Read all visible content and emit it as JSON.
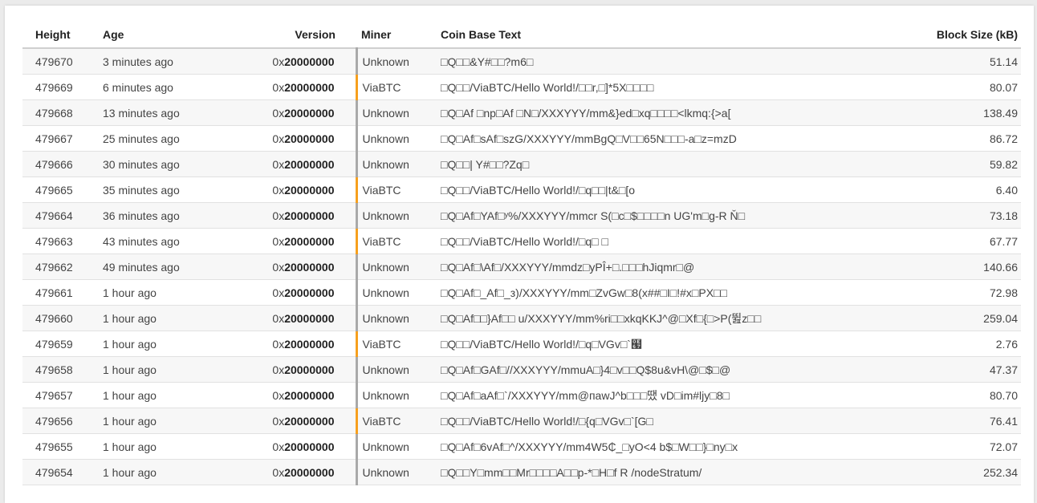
{
  "table": {
    "columns": {
      "height": "Height",
      "age": "Age",
      "version": "Version",
      "miner": "Miner",
      "coinbase": "Coin Base Text",
      "size": "Block Size (kB)"
    },
    "rows": [
      {
        "height": "479670",
        "age": "3 minutes ago",
        "version_prefix": "0x",
        "version_value": "20000000",
        "miner": "Unknown",
        "coinbase": "□Q□□&Y#□□?m6□",
        "size": "51.14"
      },
      {
        "height": "479669",
        "age": "6 minutes ago",
        "version_prefix": "0x",
        "version_value": "20000000",
        "miner": "ViaBTC",
        "coinbase": "□Q□□/ViaBTC/Hello World!/□□r,□]*5X□□□□",
        "size": "80.07"
      },
      {
        "height": "479668",
        "age": "13 minutes ago",
        "version_prefix": "0x",
        "version_value": "20000000",
        "miner": "Unknown",
        "coinbase": "□Q□Af □np□Af □N□/XXXYYY/mm&}ed□xq□□□□<lkmq:{>a[",
        "size": "138.49"
      },
      {
        "height": "479667",
        "age": "25 minutes ago",
        "version_prefix": "0x",
        "version_value": "20000000",
        "miner": "Unknown",
        "coinbase": "□Q□Af□sAf□szG/XXXYYY/mmBgQ□V□□65N□□□-a□z=mzD",
        "size": "86.72"
      },
      {
        "height": "479666",
        "age": "30 minutes ago",
        "version_prefix": "0x",
        "version_value": "20000000",
        "miner": "Unknown",
        "coinbase": "□Q□□| Y#□□?Zq□",
        "size": "59.82"
      },
      {
        "height": "479665",
        "age": "35 minutes ago",
        "version_prefix": "0x",
        "version_value": "20000000",
        "miner": "ViaBTC",
        "coinbase": "□Q□□/ViaBTC/Hello World!/□q□□|t&□[o",
        "size": "6.40"
      },
      {
        "height": "479664",
        "age": "36 minutes ago",
        "version_prefix": "0x",
        "version_value": "20000000",
        "miner": "Unknown",
        "coinbase": "□Q□Af□YAf□ʸ%/XXXYYY/mmcr S(□c□$□□□□n UG'm□g-R Ň□",
        "size": "73.18"
      },
      {
        "height": "479663",
        "age": "43 minutes ago",
        "version_prefix": "0x",
        "version_value": "20000000",
        "miner": "ViaBTC",
        "coinbase": "□Q□□/ViaBTC/Hello World!/□q□ □",
        "size": "67.77"
      },
      {
        "height": "479662",
        "age": "49 minutes ago",
        "version_prefix": "0x",
        "version_value": "20000000",
        "miner": "Unknown",
        "coinbase": "□Q□Af□\\Af□/XXXYYY/mmdz□yPÎ+□.□□□hJiqmr□@",
        "size": "140.66"
      },
      {
        "height": "479661",
        "age": "1 hour ago",
        "version_prefix": "0x",
        "version_value": "20000000",
        "miner": "Unknown",
        "coinbase": "□Q□Af□_Af□_з)/XXXYYY/mm□ZvGw□8(x##□I□!#x□PX□□",
        "size": "72.98"
      },
      {
        "height": "479660",
        "age": "1 hour ago",
        "version_prefix": "0x",
        "version_value": "20000000",
        "miner": "Unknown",
        "coinbase": "□Q□Af□□}Af□□ u/XXXYYY/mm%ri□□xkqKKJ^@□Xf□{□>P(뛾z□□",
        "size": "259.04"
      },
      {
        "height": "479659",
        "age": "1 hour ago",
        "version_prefix": "0x",
        "version_value": "20000000",
        "miner": "ViaBTC",
        "coinbase": "□Q□□/ViaBTC/Hello World!/□q□VGv□`๧",
        "size": "2.76"
      },
      {
        "height": "479658",
        "age": "1 hour ago",
        "version_prefix": "0x",
        "version_value": "20000000",
        "miner": "Unknown",
        "coinbase": "□Q□Af□GAf□//XXXYYY/mmuA□}4□v□□Q$8u&vH\\@□$□@",
        "size": "47.37"
      },
      {
        "height": "479657",
        "age": "1 hour ago",
        "version_prefix": "0x",
        "version_value": "20000000",
        "miner": "Unknown",
        "coinbase": "□Q□Af□aAf□`/XXXYYY/mm@пawJ^b□□□땠 vD□im#ljy□8□",
        "size": "80.70"
      },
      {
        "height": "479656",
        "age": "1 hour ago",
        "version_prefix": "0x",
        "version_value": "20000000",
        "miner": "ViaBTC",
        "coinbase": "□Q□□/ViaBTC/Hello World!/□{q□VGv□`[G□",
        "size": "76.41"
      },
      {
        "height": "479655",
        "age": "1 hour ago",
        "version_prefix": "0x",
        "version_value": "20000000",
        "miner": "Unknown",
        "coinbase": "□Q□Af□6vAf□^/XXXYYY/mm4W5₵_□yO<4 b$□W□□}□ny□x",
        "size": "72.07"
      },
      {
        "height": "479654",
        "age": "1 hour ago",
        "version_prefix": "0x",
        "version_value": "20000000",
        "miner": "Unknown",
        "coinbase": "□Q□□Y□mm□□Mr□□□□A□□p-*□H□f R /nodeStratum/",
        "size": "252.34"
      }
    ]
  },
  "colors": {
    "viabtc_marker": "#f7a01e",
    "unknown_marker": "#a9a9a9"
  }
}
